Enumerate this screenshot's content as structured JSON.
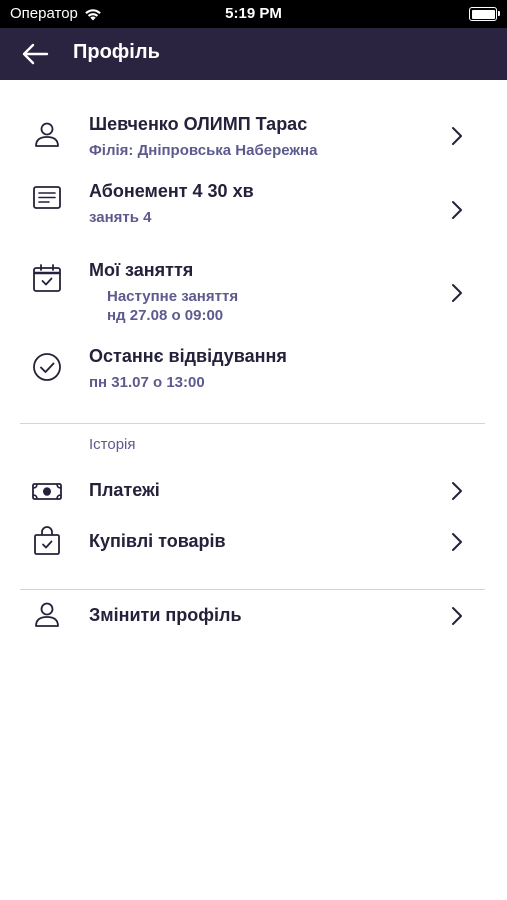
{
  "status_bar": {
    "carrier": "Оператор",
    "time": "5:19 PM"
  },
  "header": {
    "title": "Профіль"
  },
  "profile": {
    "name": "Шевченко ОЛИМП Тарас",
    "branch": "Філія: Дніпровська Набережна"
  },
  "subscription": {
    "title": "Абонемент 4 30 хв",
    "sessions": "занять 4"
  },
  "my_classes": {
    "title": "Мої заняття",
    "next_label": "Наступне заняття",
    "next_date": "нд 27.08 о 09:00"
  },
  "last_visit": {
    "title": "Останнє відвідування",
    "date": "пн 31.07 о 13:00"
  },
  "history": {
    "section_label": "Історія",
    "payments": "Платежі",
    "purchases": "Купівлі товарів"
  },
  "edit_profile": {
    "label": "Змінити профіль"
  },
  "colors": {
    "header_bg": "#2b2440",
    "accent_text": "#5d5a8e",
    "primary_text": "#24223a"
  }
}
